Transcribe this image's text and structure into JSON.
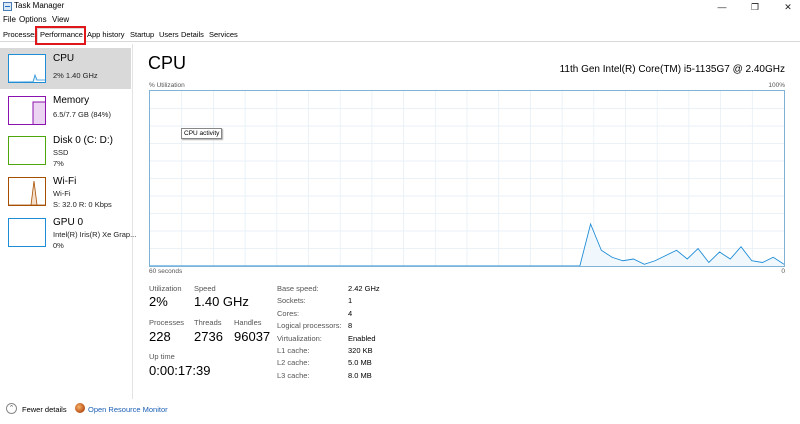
{
  "window": {
    "title": "Task Manager",
    "minimize": "—",
    "maximize": "❐",
    "close": "✕"
  },
  "menu": [
    "File",
    "Options",
    "View"
  ],
  "tabs": [
    "Processes",
    "Performance",
    "App history",
    "Startup",
    "Users",
    "Details",
    "Services"
  ],
  "active_tab": "Performance",
  "sidebar": {
    "items": [
      {
        "title": "CPU",
        "sub1": "2%  1.40 GHz",
        "sub2": "",
        "sub3": "",
        "color": "#1f8dd6"
      },
      {
        "title": "Memory",
        "sub1": "6.5/7.7 GB (84%)",
        "sub2": "",
        "sub3": "",
        "color": "#8b12ae"
      },
      {
        "title": "Disk 0 (C: D:)",
        "sub1": "SSD",
        "sub2": "7%",
        "sub3": "",
        "color": "#4da60c"
      },
      {
        "title": "Wi-Fi",
        "sub1": "Wi-Fi",
        "sub2": "S: 32.0  R: 0 Kbps",
        "sub3": "",
        "color": "#a74f01"
      },
      {
        "title": "GPU 0",
        "sub1": "Intel(R) Iris(R) Xe Grap...",
        "sub2": "0%",
        "sub3": "",
        "color": "#1f8dd6"
      }
    ]
  },
  "main": {
    "title": "CPU",
    "model": "11th Gen Intel(R) Core(TM) i5-1135G7 @ 2.40GHz",
    "axis_label": "% Utilization",
    "axis_max": "100%",
    "axis_time": "60 seconds",
    "axis_min": "0",
    "tooltip": "CPU activity"
  },
  "stats": {
    "utilization_label": "Utilization",
    "utilization": "2%",
    "speed_label": "Speed",
    "speed": "1.40 GHz",
    "processes_label": "Processes",
    "processes": "228",
    "threads_label": "Threads",
    "threads": "2736",
    "handles_label": "Handles",
    "handles": "96037",
    "uptime_label": "Up time",
    "uptime": "0:00:17:39"
  },
  "details": [
    {
      "label": "Base speed:",
      "value": "2.42 GHz"
    },
    {
      "label": "Sockets:",
      "value": "1"
    },
    {
      "label": "Cores:",
      "value": "4"
    },
    {
      "label": "Logical processors:",
      "value": "8"
    },
    {
      "label": "Virtualization:",
      "value": "Enabled"
    },
    {
      "label": "L1 cache:",
      "value": "320 KB"
    },
    {
      "label": "L2 cache:",
      "value": "5.0 MB"
    },
    {
      "label": "L3 cache:",
      "value": "8.0 MB"
    }
  ],
  "footer": {
    "fewer_details": "Fewer details",
    "resource_monitor": "Open Resource Monitor"
  },
  "cpu_history_percent": [
    0,
    0,
    0,
    0,
    0,
    0,
    0,
    0,
    0,
    0,
    0,
    0,
    0,
    0,
    0,
    0,
    0,
    0,
    0,
    0,
    0,
    0,
    0,
    0,
    0,
    0,
    0,
    0,
    0,
    0,
    0,
    0,
    0,
    0,
    0,
    0,
    0,
    0,
    0,
    0,
    0,
    24,
    9,
    5,
    3,
    4,
    1,
    3,
    6,
    9,
    4,
    10,
    2,
    8,
    4,
    11,
    3,
    2,
    5,
    1
  ]
}
